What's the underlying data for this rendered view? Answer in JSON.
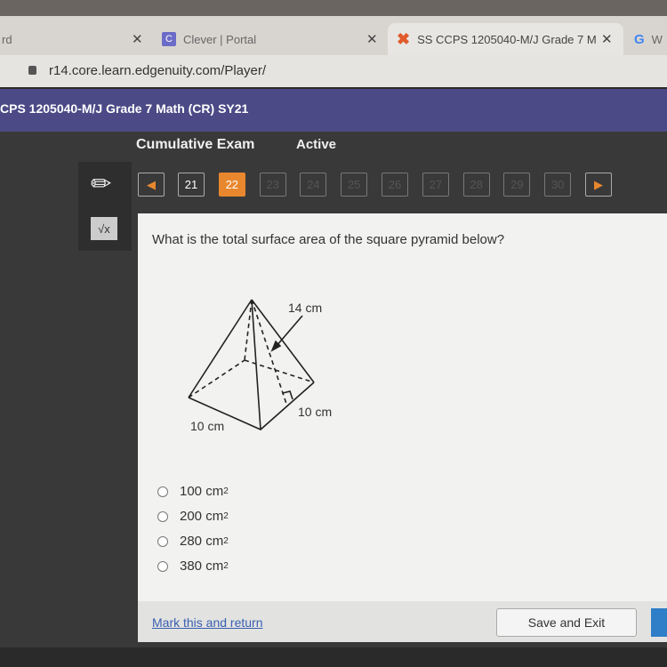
{
  "browser": {
    "tabs": [
      {
        "title": "rd"
      },
      {
        "title": "Clever | Portal",
        "icon": "clever-icon"
      },
      {
        "title": "SS CCPS 1205040-M/J Grade 7 M",
        "icon": "edgenuity-icon",
        "active": true
      },
      {
        "title": "W",
        "icon": "google-icon"
      }
    ],
    "url": "r14.core.learn.edgenuity.com/Player/"
  },
  "header": {
    "course": "CPS 1205040-M/J Grade 7 Math (CR) SY21"
  },
  "exam": {
    "title": "Cumulative Exam",
    "status": "Active"
  },
  "pagination": {
    "pages": [
      "21",
      "22",
      "23",
      "24",
      "25",
      "26",
      "27",
      "28",
      "29",
      "30"
    ],
    "current": "22",
    "prev_icon": "caret-left-icon",
    "next_icon": "caret-right-icon"
  },
  "tools": [
    "pencil-icon",
    "square-root-icon"
  ],
  "question": {
    "text": "What is the total surface area of the square pyramid below?",
    "figure": {
      "slant": "14 cm",
      "side_right": "10 cm",
      "side_left": "10 cm"
    },
    "options": [
      {
        "value": "100 cm",
        "exp": "2"
      },
      {
        "value": "200 cm",
        "exp": "2"
      },
      {
        "value": "280 cm",
        "exp": "2"
      },
      {
        "value": "380 cm",
        "exp": "2"
      }
    ]
  },
  "footer": {
    "mark": "Mark this and return",
    "save": "Save and Exit"
  },
  "colors": {
    "header": "#4c4a86",
    "current_page": "#e8872e",
    "link": "#3a5fb0"
  }
}
